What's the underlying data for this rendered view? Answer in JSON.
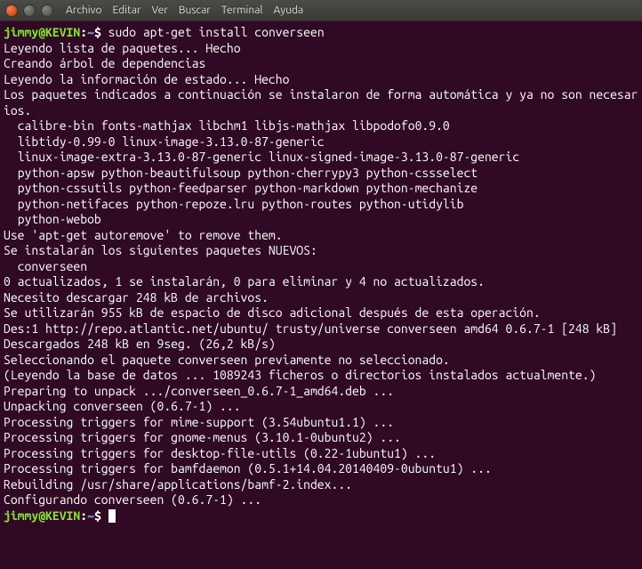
{
  "titlebar": {
    "menus": [
      "Archivo",
      "Editar",
      "Ver",
      "Buscar",
      "Terminal",
      "Ayuda"
    ]
  },
  "prompt": {
    "userhost": "jimmy@KEVIN",
    "colon": ":",
    "path": "~",
    "symbol": "$"
  },
  "command": "sudo apt-get install converseen",
  "output_lines": [
    "Leyendo lista de paquetes... Hecho",
    "Creando árbol de dependencias",
    "Leyendo la información de estado... Hecho",
    "Los paquetes indicados a continuación se instalaron de forma automática y ya no son necesarios.",
    "  calibre-bin fonts-mathjax libchm1 libjs-mathjax libpodofo0.9.0",
    "  libtidy-0.99-0 linux-image-3.13.0-87-generic",
    "  linux-image-extra-3.13.0-87-generic linux-signed-image-3.13.0-87-generic",
    "  python-apsw python-beautifulsoup python-cherrypy3 python-cssselect",
    "  python-cssutils python-feedparser python-markdown python-mechanize",
    "  python-netifaces python-repoze.lru python-routes python-utidylib",
    "  python-webob",
    "Use 'apt-get autoremove' to remove them.",
    "Se instalarán los siguientes paquetes NUEVOS:",
    "  converseen",
    "0 actualizados, 1 se instalarán, 0 para eliminar y 4 no actualizados.",
    "Necesito descargar 248 kB de archivos.",
    "Se utilizarán 955 kB de espacio de disco adicional después de esta operación.",
    "Des:1 http://repo.atlantic.net/ubuntu/ trusty/universe converseen amd64 0.6.7-1 [248 kB]",
    "Descargados 248 kB en 9seg. (26,2 kB/s)",
    "Seleccionando el paquete converseen previamente no seleccionado.",
    "(Leyendo la base de datos ... 1089243 ficheros o directorios instalados actualmente.)",
    "Preparing to unpack .../converseen_0.6.7-1_amd64.deb ...",
    "Unpacking converseen (0.6.7-1) ...",
    "Processing triggers for mime-support (3.54ubuntu1.1) ...",
    "Processing triggers for gnome-menus (3.10.1-0ubuntu2) ...",
    "Processing triggers for desktop-file-utils (0.22-1ubuntu1) ...",
    "Processing triggers for bamfdaemon (0.5.1+14.04.20140409-0ubuntu1) ...",
    "Rebuilding /usr/share/applications/bamf-2.index...",
    "Configurando converseen (0.6.7-1) ..."
  ]
}
